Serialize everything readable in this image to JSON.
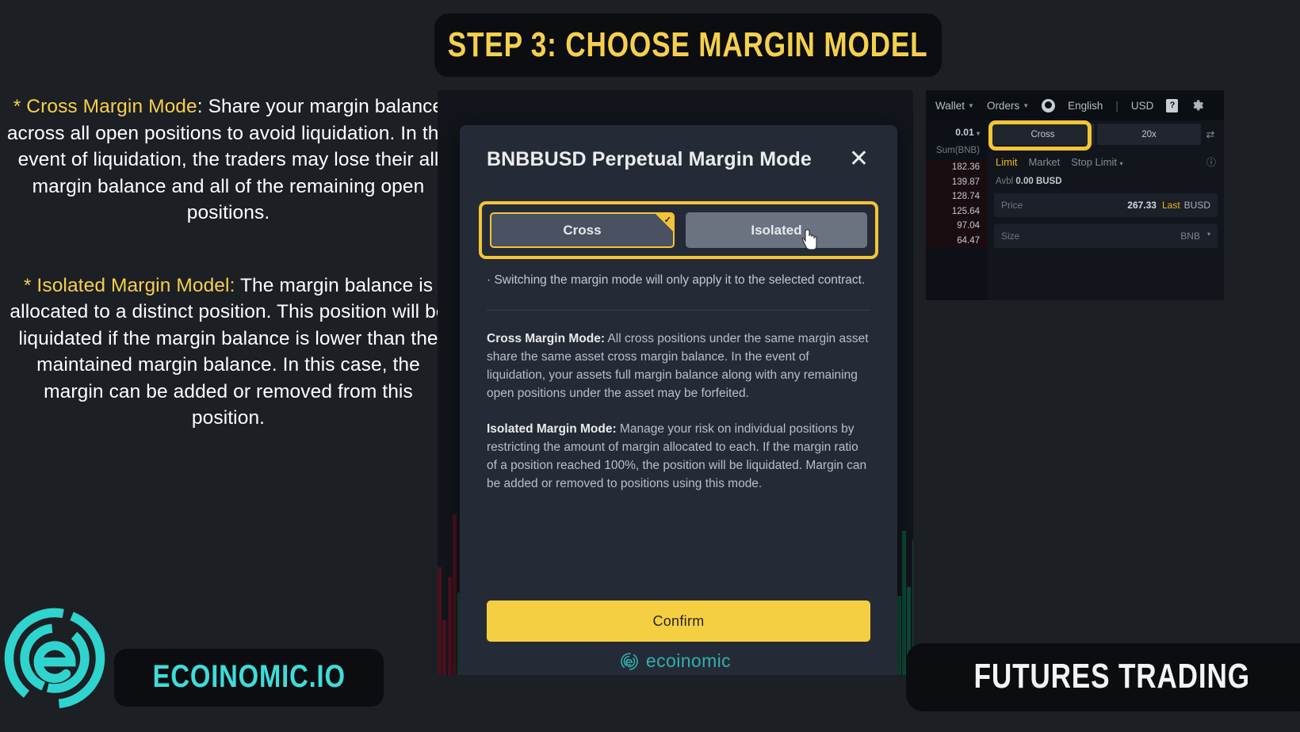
{
  "banner": {
    "title": "STEP 3: CHOOSE MARGIN MODEL"
  },
  "left": {
    "para1_label": "* Cross Margin Mode",
    "para1_rest": ": Share your margin balance across all open positions to avoid liquidation. In the event of liquidation, the traders may lose their all margin balance and all of the remaining open positions.",
    "para2_label": "* Isolated Margin Model:",
    "para2_rest": " The margin balance is allocated to a distinct position. This position will be liquidated if the margin balance is lower than the maintained margin balance. In this case, the margin can be added or removed from this position."
  },
  "modal": {
    "title": "BNBBUSD Perpetual Margin Mode",
    "close_icon": "close-icon",
    "toggle": {
      "cross_label": "Cross",
      "isolated_label": "Isolated",
      "selected": "Cross",
      "check_glyph": "✓"
    },
    "note": "· Switching the margin mode will only apply it to the selected contract.",
    "cross_heading": "Cross Margin Mode:",
    "cross_body": " All cross positions under the same margin asset share the same asset cross margin balance. In the event of liquidation, your assets full margin balance along with any remaining open positions under the asset may be forfeited.",
    "isolated_heading": "Isolated Margin Mode:",
    "isolated_body": " Manage your risk on individual positions by restricting the amount of margin allocated to each. If the margin ratio of a position reached 100%, the position will be liquidated. Margin can be added or removed to positions using this mode.",
    "confirm_label": "Confirm",
    "watermark_text": "ecoinomic"
  },
  "trading": {
    "nav": {
      "wallet": "Wallet",
      "orders": "Orders",
      "account_icon": "account-icon",
      "language": "English",
      "separator": "|",
      "currency": "USD",
      "doc_icon": "doc-help-icon",
      "gear_icon": "gear-icon"
    },
    "mode": {
      "margin_label": "Cross",
      "leverage_label": "20x",
      "swap_icon": "swap-icon"
    },
    "order_tabs": {
      "limit": "Limit",
      "market": "Market",
      "stop_limit": "Stop Limit",
      "info_icon": "info-icon"
    },
    "avbl_label": "Avbl",
    "avbl_value": "0.00 BUSD",
    "price_field": {
      "placeholder": "Price",
      "value": "267.33",
      "unit": "Last",
      "unit2": "BUSD"
    },
    "size_field": {
      "placeholder": "Size",
      "unit": "BNB",
      "caret": "▾"
    },
    "orderbook": {
      "tick_size": "0.01",
      "sum_header": "Sum(BNB)",
      "rows": [
        "182.36",
        "139.87",
        "128.74",
        "125.64",
        "97.04",
        "64.47"
      ]
    }
  },
  "brand": {
    "name": "ECOINOMIC.IO"
  },
  "footer_badge": {
    "text": "FUTURES TRADING"
  },
  "colors": {
    "accent_yellow": "#f3c536",
    "brand_teal": "#3fdcd8",
    "page_bg": "#1c1f24",
    "modal_bg": "#252b36",
    "confirm_bg": "#f5cf42"
  }
}
